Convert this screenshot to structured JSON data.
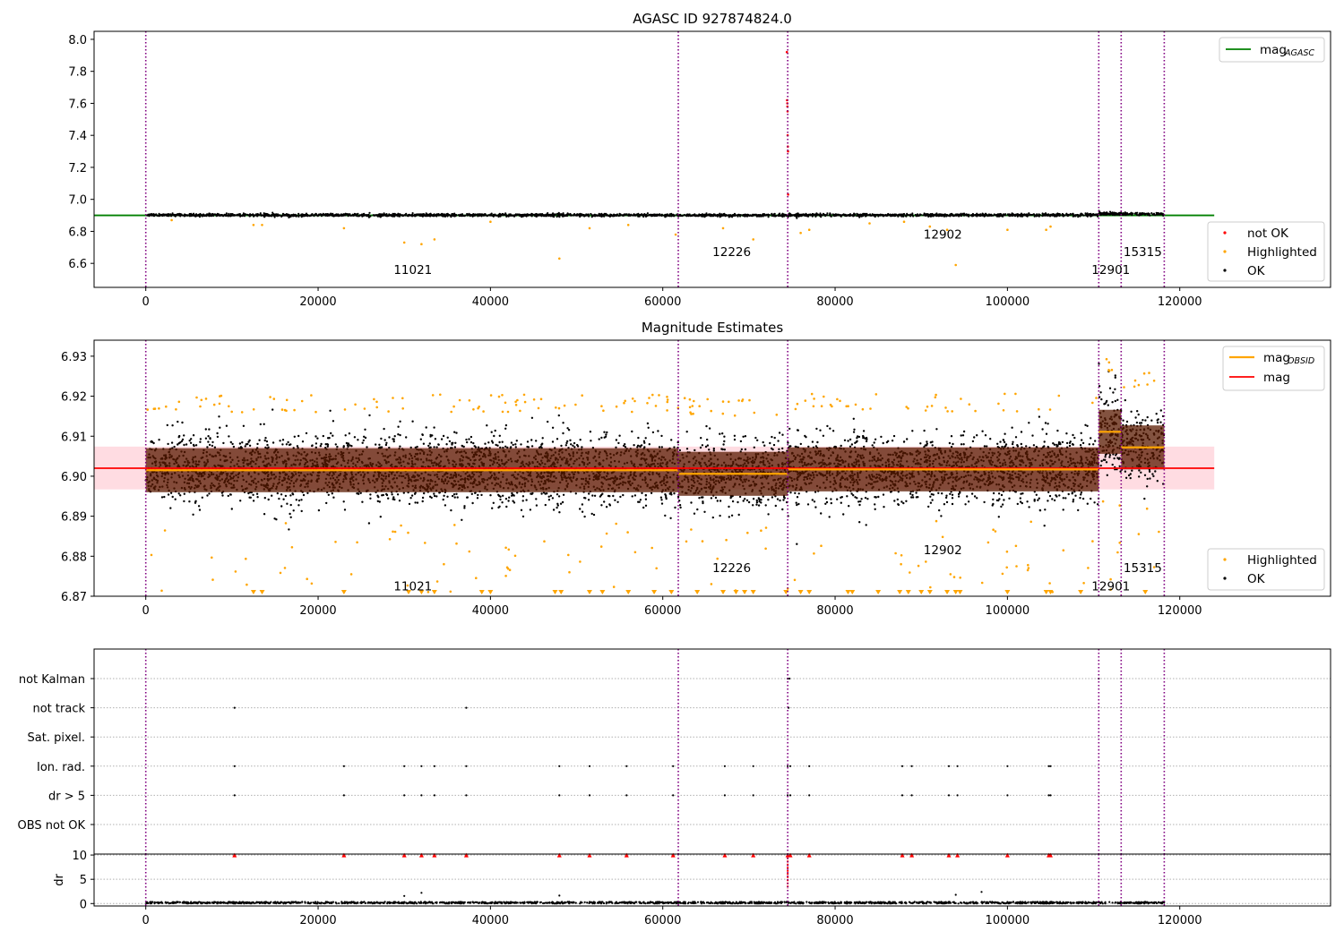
{
  "colors": {
    "ok": "#000000",
    "highlighted": "#ffa500",
    "not_ok": "#ff0000",
    "mag_agasc": "#008000",
    "mag": "#ff0000",
    "mag_obsid": "#ffa500",
    "obs_boundary": "#800080",
    "band": "#ffc0cb"
  },
  "obs_boundaries": [
    0,
    61800,
    74500,
    110600,
    113200,
    118200
  ],
  "obs_segments": [
    {
      "obsid": "11021",
      "x": 31000,
      "x_range": [
        0,
        61800
      ],
      "mag": 6.9015
    },
    {
      "obsid": "12226",
      "x": 68000,
      "x_range": [
        61800,
        74500
      ],
      "mag": 6.9006
    },
    {
      "obsid": "12902",
      "x": 92500,
      "x_range": [
        74500,
        110600
      ],
      "mag": 6.9017
    },
    {
      "obsid": "12901",
      "x": 112000,
      "x_range": [
        110600,
        113200
      ],
      "mag": 6.9111
    },
    {
      "obsid": "15315",
      "x": 115700,
      "x_range": [
        113200,
        118200
      ],
      "mag": 6.9072
    }
  ],
  "chart_data": [
    {
      "type": "scatter",
      "title": "AGASC ID 927874824.0",
      "xlim": [
        -6000,
        137500
      ],
      "ylim": [
        6.45,
        8.05
      ],
      "xticks": [
        0,
        20000,
        40000,
        60000,
        80000,
        100000,
        120000
      ],
      "yticks": [
        6.6,
        6.8,
        7.0,
        7.2,
        7.4,
        7.6,
        7.8,
        8.0
      ],
      "ytick_labels": [
        "6.6",
        "6.8",
        "7.0",
        "7.2",
        "7.4",
        "7.6",
        "7.8",
        "8.0"
      ],
      "mag_agasc": 6.9,
      "mag_agasc_x": [
        -6000,
        124000
      ],
      "series": [
        {
          "name": "not OK",
          "x": [
            74400,
            74420,
            74450,
            74460,
            74480,
            74500,
            74520,
            74540,
            74550
          ],
          "y": [
            7.92,
            7.62,
            7.6,
            7.58,
            7.55,
            7.4,
            7.33,
            7.3,
            7.03
          ]
        },
        {
          "name": "Highlighted",
          "x": [
            3000,
            12500,
            13500,
            23000,
            30000,
            32000,
            33500,
            40000,
            48000,
            51500,
            56000,
            61500,
            67000,
            70500,
            76000,
            77000,
            84000,
            88000,
            91000,
            93000,
            94000,
            100000,
            104500,
            105000
          ],
          "y": [
            6.87,
            6.84,
            6.84,
            6.82,
            6.73,
            6.72,
            6.75,
            6.86,
            6.63,
            6.82,
            6.84,
            6.78,
            6.82,
            6.75,
            6.79,
            6.81,
            6.85,
            6.86,
            6.83,
            6.81,
            6.59,
            6.81,
            6.81,
            6.83
          ]
        },
        {
          "name": "OK"
        }
      ],
      "legend_top": [
        "mag"
      ],
      "legend_top_sub": "AGASC",
      "legend_bottom": [
        "not OK",
        "Highlighted",
        "OK"
      ]
    },
    {
      "type": "scatter",
      "title": "Magnitude Estimates",
      "xlim": [
        -6000,
        137500
      ],
      "ylim": [
        6.87,
        6.934
      ],
      "xticks": [
        0,
        20000,
        40000,
        60000,
        80000,
        100000,
        120000
      ],
      "yticks": [
        6.87,
        6.88,
        6.89,
        6.9,
        6.91,
        6.92,
        6.93
      ],
      "ytick_labels": [
        "6.87",
        "6.88",
        "6.89",
        "6.90",
        "6.91",
        "6.92",
        "6.93"
      ],
      "mag": 6.902,
      "mag_band": [
        6.8967,
        6.9074
      ],
      "series": [
        {
          "name": "Highlighted"
        },
        {
          "name": "OK"
        }
      ],
      "legend_top": [
        "mag",
        "mag"
      ],
      "legend_top_sub": "OBSID",
      "legend_bottom": [
        "Highlighted",
        "OK"
      ]
    },
    {
      "type": "scatter",
      "xlim": [
        -6000,
        137500
      ],
      "xticks": [
        0,
        20000,
        40000,
        60000,
        80000,
        100000,
        120000
      ],
      "categories": [
        "not Kalman",
        "not track",
        "Sat. pixel.",
        "Ion. rad.",
        "dr > 5",
        "OBS not OK"
      ],
      "flag_points": {
        "not Kalman": [
          74500,
          74700,
          110600
        ],
        "not track": [
          10300,
          37200,
          74600
        ],
        "Sat. pixel.": [],
        "Ion. rad.": [
          10300,
          23000,
          30000,
          32000,
          33500,
          37200,
          48000,
          51500,
          55800,
          61200,
          67200,
          70500,
          74500,
          74800,
          77000,
          87800,
          88900,
          93200,
          94200,
          100000,
          104800,
          105000
        ],
        "dr > 5": [
          10300,
          23000,
          30000,
          32000,
          33500,
          37200,
          48000,
          51500,
          55800,
          61200,
          67200,
          70500,
          74500,
          74800,
          77000,
          87800,
          88900,
          93200,
          94200,
          100000,
          104800,
          105000
        ],
        "OBS not OK": []
      },
      "dr_yticks": [
        0,
        5,
        10
      ],
      "dr_ylim": [
        -0.5,
        10.2
      ],
      "ylabel": "dr"
    }
  ]
}
